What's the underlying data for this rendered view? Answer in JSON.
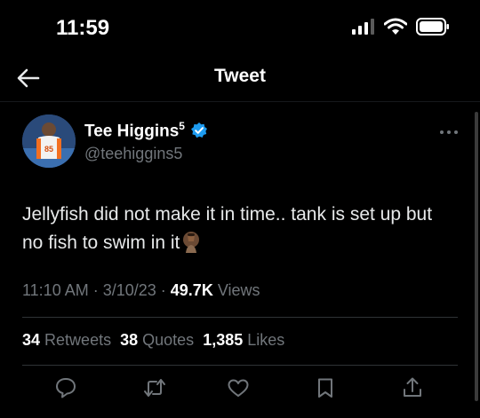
{
  "status": {
    "time": "11:59"
  },
  "nav": {
    "title": "Tweet"
  },
  "author": {
    "name": "Tee Higgins",
    "sup": "5",
    "handle": "@teehiggins5"
  },
  "tweet": {
    "text": "Jellyfish did not make it in time.. tank is set up but no fish to swim in it"
  },
  "meta": {
    "time": "11:10 AM",
    "sep1": " · ",
    "date": "3/10/23",
    "sep2": " · ",
    "views": "49.7K",
    "views_label": "Views"
  },
  "stats": {
    "retweets": "34",
    "retweets_label": "Retweets",
    "quotes": "38",
    "quotes_label": "Quotes",
    "likes": "1,385",
    "likes_label": "Likes"
  },
  "icons": [
    "back-arrow-icon",
    "verified-badge-icon",
    "more-icon",
    "reply-icon",
    "retweet-icon",
    "like-icon",
    "bookmark-icon",
    "share-icon",
    "facepalm-emoji-icon"
  ]
}
